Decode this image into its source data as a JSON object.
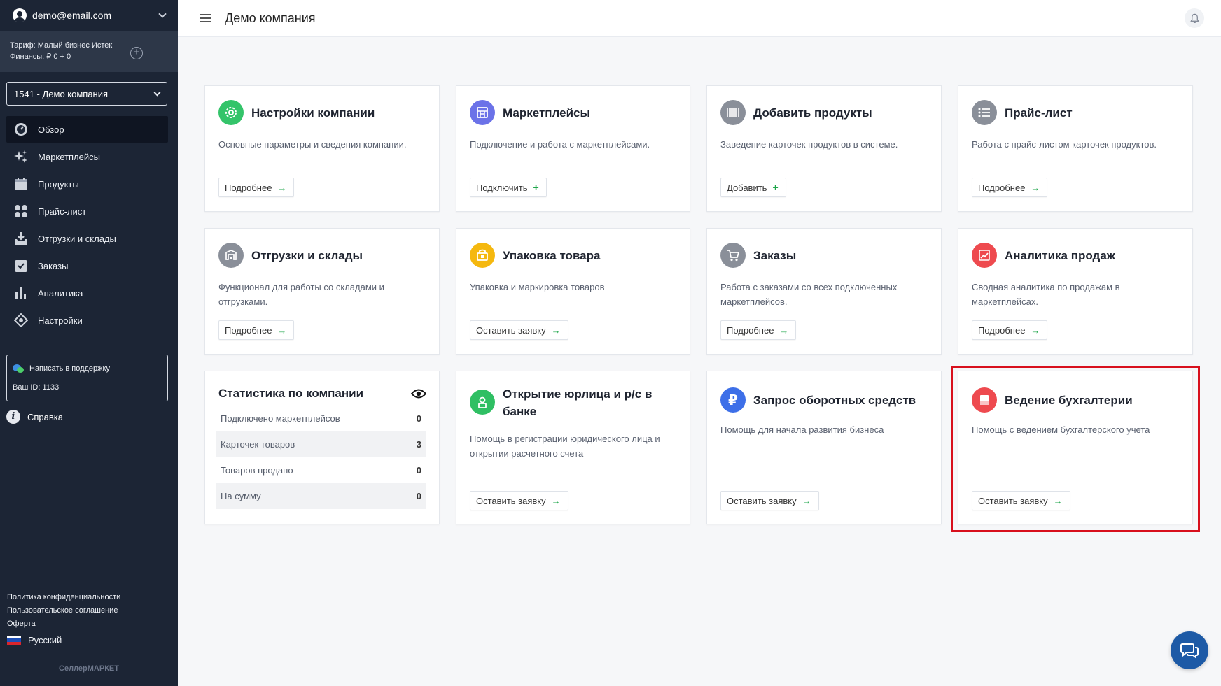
{
  "sidebar": {
    "user_email": "demo@email.com",
    "tariff_line": "Тариф: Малый бизнес Истек",
    "finance_line": "Финансы: ₽ 0 + 0",
    "company_select": "1541 - Демо компания",
    "nav": [
      {
        "label": "Обзор",
        "icon": "overview-icon"
      },
      {
        "label": "Маркетплейсы",
        "icon": "sparkles-icon"
      },
      {
        "label": "Продукты",
        "icon": "calendar-icon"
      },
      {
        "label": "Прайс-лист",
        "icon": "dots-icon"
      },
      {
        "label": "Отгрузки и склады",
        "icon": "inbox-download-icon"
      },
      {
        "label": "Заказы",
        "icon": "clipboard-icon"
      },
      {
        "label": "Аналитика",
        "icon": "bar-chart-icon"
      },
      {
        "label": "Настройки",
        "icon": "settings-diamond-icon"
      }
    ],
    "support_label": "Написать в поддержку",
    "support_id": "Ваш ID: 1133",
    "help_label": "Справка",
    "footer": {
      "privacy": "Политика конфиденциальности",
      "agreement": "Пользовательское соглашение",
      "offer": "Оферта",
      "language": "Русский"
    },
    "brand": "СеллерМАРКЕТ"
  },
  "header": {
    "title": "Демо компания"
  },
  "cards": {
    "company_settings": {
      "title": "Настройки компании",
      "desc": "Основные параметры и сведения компании.",
      "button": "Подробнее",
      "color": "#34c46a"
    },
    "marketplaces": {
      "title": "Маркетплейсы",
      "desc": "Подключение и работа с маркетплейсами.",
      "button": "Подключить",
      "color": "#6b72e8"
    },
    "add_products": {
      "title": "Добавить продукты",
      "desc": "Заведение карточек продуктов в системе.",
      "button": "Добавить",
      "color": "#8a8f99"
    },
    "price_list": {
      "title": "Прайс-лист",
      "desc": "Работа с прайс-листом карточек продуктов.",
      "button": "Подробнее",
      "color": "#8a8f99"
    },
    "shipments": {
      "title": "Отгрузки и склады",
      "desc": "Функционал для работы со складами и отгрузками.",
      "button": "Подробнее",
      "color": "#8a8f99"
    },
    "packaging": {
      "title": "Упаковка товара",
      "desc": "Упаковка и маркировка товаров",
      "button": "Оставить заявку",
      "color": "#f5b80f"
    },
    "orders": {
      "title": "Заказы",
      "desc": "Работа с заказами со всех подключенных маркетплейсов.",
      "button": "Подробнее",
      "color": "#8a8f99"
    },
    "sales_analytics": {
      "title": "Аналитика продаж",
      "desc": "Сводная аналитика по продажам в маркетплейсах.",
      "button": "Подробнее",
      "color": "#ee4a4f"
    },
    "legal_entity": {
      "title": "Открытие юрлица и р/с в банке",
      "desc": "Помощь в регистрации юридического лица и открытии расчетного счета",
      "button": "Оставить заявку",
      "color": "#2fbf63"
    },
    "working_capital": {
      "title": "Запрос оборотных средств",
      "desc": "Помощь для начала развития бизнеса",
      "button": "Оставить заявку",
      "color": "#3d6fe8"
    },
    "accounting": {
      "title": "Ведение бухгалтерии",
      "desc": "Помощь с ведением бухгалтерского учета",
      "button": "Оставить заявку",
      "color": "#ee4a4f"
    }
  },
  "stats": {
    "title": "Статистика по компании",
    "rows": [
      {
        "label": "Подключено маркетплейсов",
        "value": "0"
      },
      {
        "label": "Карточек товаров",
        "value": "3"
      },
      {
        "label": "Товаров продано",
        "value": "0"
      },
      {
        "label": "На сумму",
        "value": "0"
      }
    ]
  },
  "colors": {
    "sidebar_bg": "#1c2535",
    "accent_green": "#1ea64a",
    "highlight": "#d8101d",
    "chat_fab": "#1d5aa6"
  }
}
